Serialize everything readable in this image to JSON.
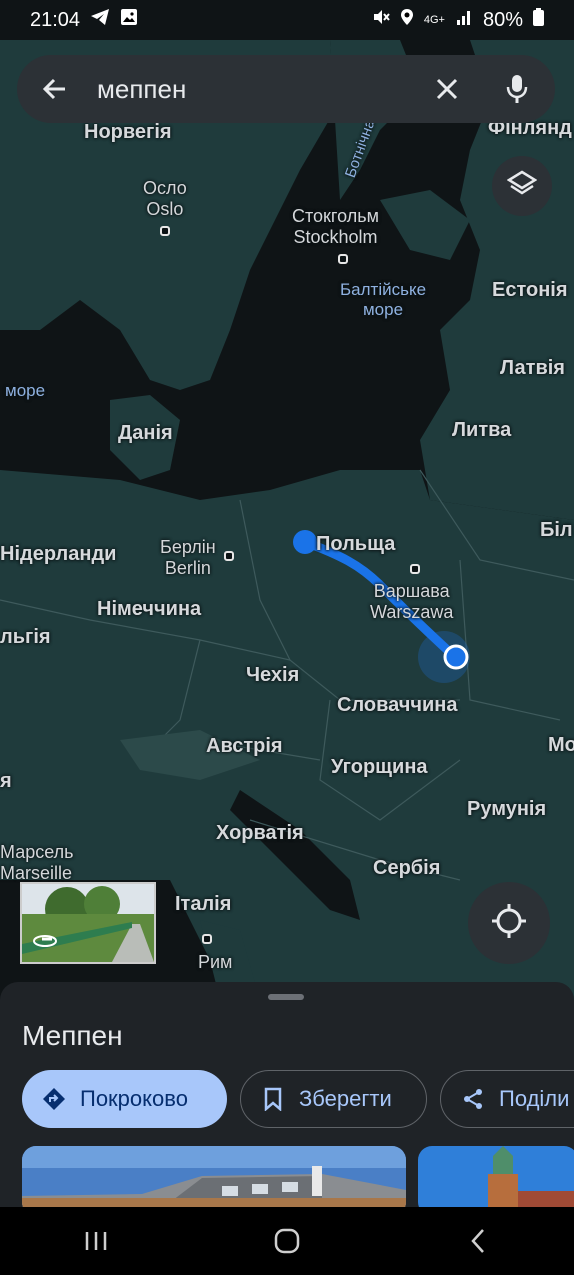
{
  "status_bar": {
    "time": "21:04",
    "battery": "80%",
    "network": "4G+"
  },
  "search": {
    "query": "меппен"
  },
  "map": {
    "countries": [
      "Норвегія",
      "Фінлянд",
      "Естонія",
      "Латвія",
      "Литва",
      "Данія",
      "Польща",
      "Нідерланди",
      "Німеччина",
      "льгія",
      "Чехія",
      "Словаччина",
      "Австрія",
      "Угорщина",
      "Румунія",
      "Хорватія",
      "Сербія",
      "Італія",
      "Біл",
      "Мо",
      "я"
    ],
    "cities": {
      "oslo": "Осло\nOslo",
      "stockholm": "Стокгольм\nStockholm",
      "berlin": "Берлін\nBerlin",
      "warsaw": "Варшава\nWarszawa",
      "marseille": "Марсель\nMarseille",
      "rome": "Рим"
    },
    "seas": {
      "baltic": "Балтійське\nморе",
      "north": "море",
      "bothnia": "Ботнічна"
    }
  },
  "sheet": {
    "place_name": "Меппен",
    "actions": {
      "directions": "Покроково",
      "save": "Зберегти",
      "share": "Поділи"
    }
  },
  "colors": {
    "land": "#1f3b3c",
    "water": "#0f1416",
    "route": "#1a73e8",
    "chip_primary": "#a8c7fa"
  }
}
